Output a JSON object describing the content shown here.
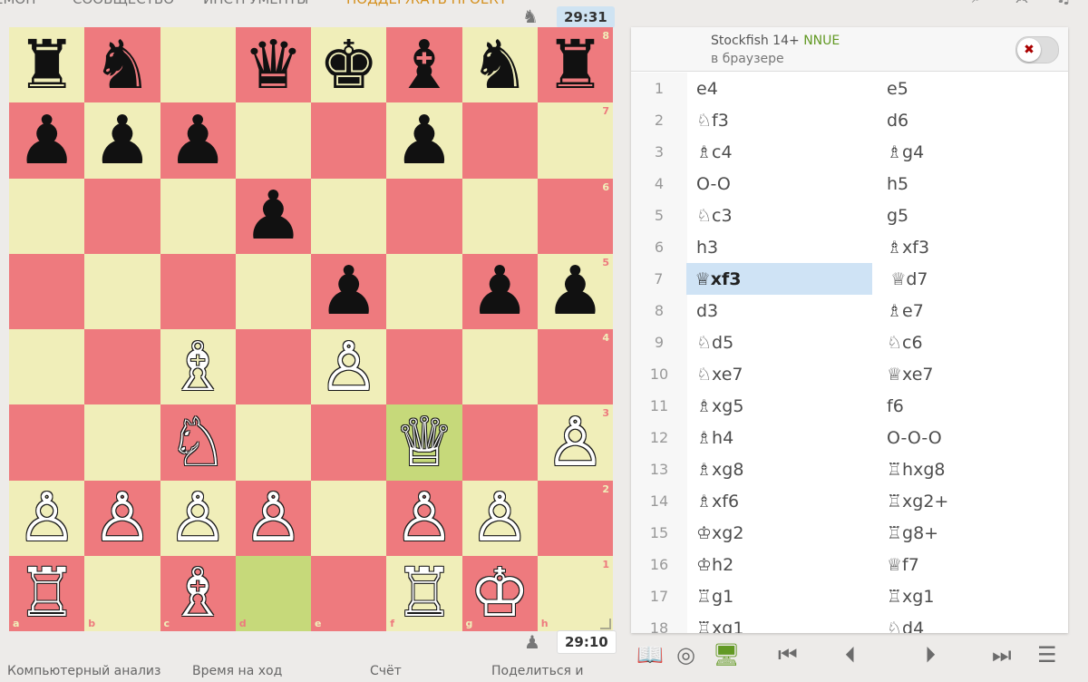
{
  "nav": {
    "items": [
      "ЕМОН",
      "СООБЩЕСТВО",
      "ИНСТРУМЕНТЫ",
      "ПОДДЕРЖАТЬ ПРОЕКТ"
    ],
    "icons": [
      "search-icon",
      "swords-icon",
      "bell-icon"
    ]
  },
  "clocks": {
    "top": "29:31",
    "bottom": "29:10"
  },
  "board": {
    "files": [
      "a",
      "b",
      "c",
      "d",
      "e",
      "f",
      "g",
      "h"
    ],
    "ranks": [
      "8",
      "7",
      "6",
      "5",
      "4",
      "3",
      "2",
      "1"
    ],
    "highlight": [
      "d1",
      "f3"
    ],
    "pieces": {
      "a8": "♜",
      "b8": "♞",
      "d8": "♛",
      "e8": "♚",
      "f8": "♝",
      "g8": "♞",
      "h8": "♜",
      "a7": "♟",
      "b7": "♟",
      "c7": "♟",
      "f7": "♟",
      "d6": "♟",
      "e5": "♟",
      "g5": "♟",
      "h5": "♟",
      "c4": "♗",
      "e4": "♙",
      "c3": "♘",
      "f3": "♕",
      "h3": "♙",
      "a2": "♙",
      "b2": "♙",
      "c2": "♙",
      "d2": "♙",
      "f2": "♙",
      "g2": "♙",
      "a1": "♖",
      "c1": "♗",
      "f1": "♖",
      "g1": "♔"
    }
  },
  "engine": {
    "name": "Stockfish 14+",
    "tag": "NNUE",
    "sub": "в браузере"
  },
  "moves": [
    {
      "n": "1",
      "w": "e4",
      "b": "e5"
    },
    {
      "n": "2",
      "w": "♘f3",
      "b": "d6"
    },
    {
      "n": "3",
      "w": "♗c4",
      "b": "♗g4"
    },
    {
      "n": "4",
      "w": "O-O",
      "b": "h5"
    },
    {
      "n": "5",
      "w": "♘c3",
      "b": "g5"
    },
    {
      "n": "6",
      "w": "h3",
      "b": "♗xf3"
    },
    {
      "n": "7",
      "w": "♕xf3",
      "b": "♕d7"
    },
    {
      "n": "8",
      "w": "d3",
      "b": "♗e7"
    },
    {
      "n": "9",
      "w": "♘d5",
      "b": "♘c6"
    },
    {
      "n": "10",
      "w": "♘xe7",
      "b": "♕xe7"
    },
    {
      "n": "11",
      "w": "♗xg5",
      "b": "f6"
    },
    {
      "n": "12",
      "w": "♗h4",
      "b": "O-O-O"
    },
    {
      "n": "13",
      "w": "♗xg8",
      "b": "♖hxg8"
    },
    {
      "n": "14",
      "w": "♗xf6",
      "b": "♖xg2+"
    },
    {
      "n": "15",
      "w": "♔xg2",
      "b": "♖g8+"
    },
    {
      "n": "16",
      "w": "♔h2",
      "b": "♕f7"
    },
    {
      "n": "17",
      "w": "♖g1",
      "b": "♖xg1"
    },
    {
      "n": "18",
      "w": "♖xg1",
      "b": "♘d4"
    }
  ],
  "active_move": {
    "row": 6,
    "side": "w"
  },
  "controls": [
    "book-icon",
    "target-icon",
    "monitor-icon",
    "first-icon",
    "prev-icon",
    "next-icon",
    "last-icon",
    "menu-icon"
  ],
  "tabs": [
    "Компьютерный анализ",
    "Время на ход",
    "Счёт",
    "Поделиться и"
  ]
}
